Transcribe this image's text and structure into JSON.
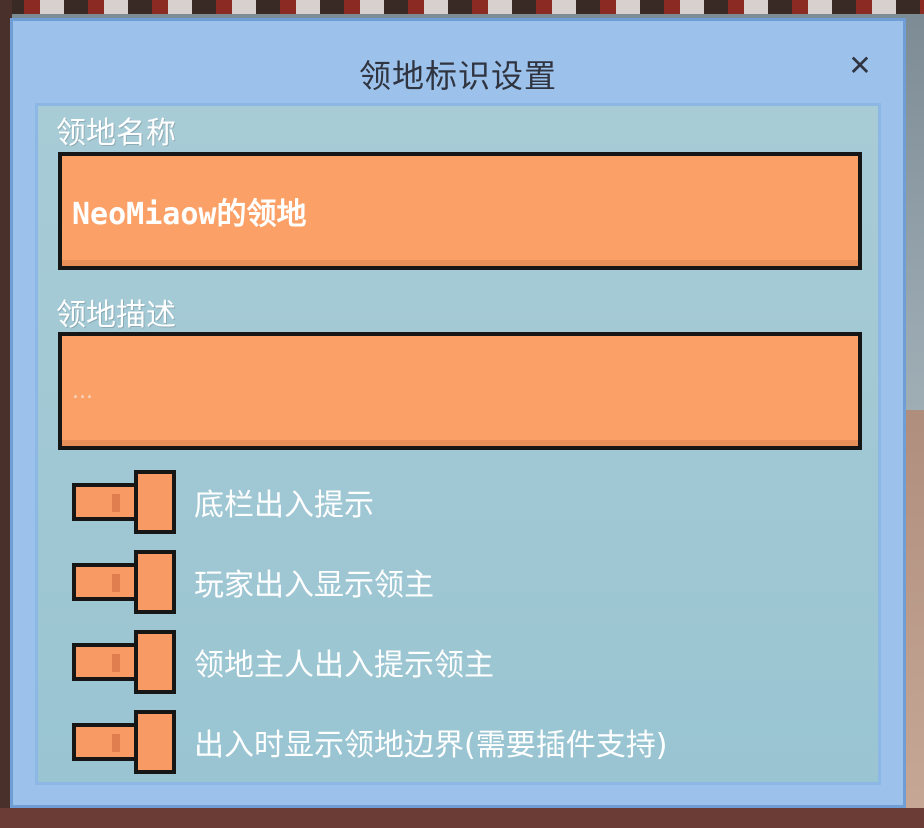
{
  "dialog": {
    "title": "领地标识设置",
    "close_icon": "close-icon"
  },
  "fields": {
    "name_label": "领地名称",
    "name_value": "NeoMiaow的领地",
    "desc_label": "领地描述",
    "desc_placeholder": "..."
  },
  "toggles": [
    {
      "label": "底栏出入提示",
      "on": false
    },
    {
      "label": "玩家出入显示领主",
      "on": false
    },
    {
      "label": "领地主人出入提示领主",
      "on": false
    },
    {
      "label": "出入时显示领地边界(需要插件支持)",
      "on": false
    }
  ],
  "colors": {
    "dialog_bg": "#9cc2ec",
    "input_bg": "#fba066",
    "border": "#161616"
  }
}
